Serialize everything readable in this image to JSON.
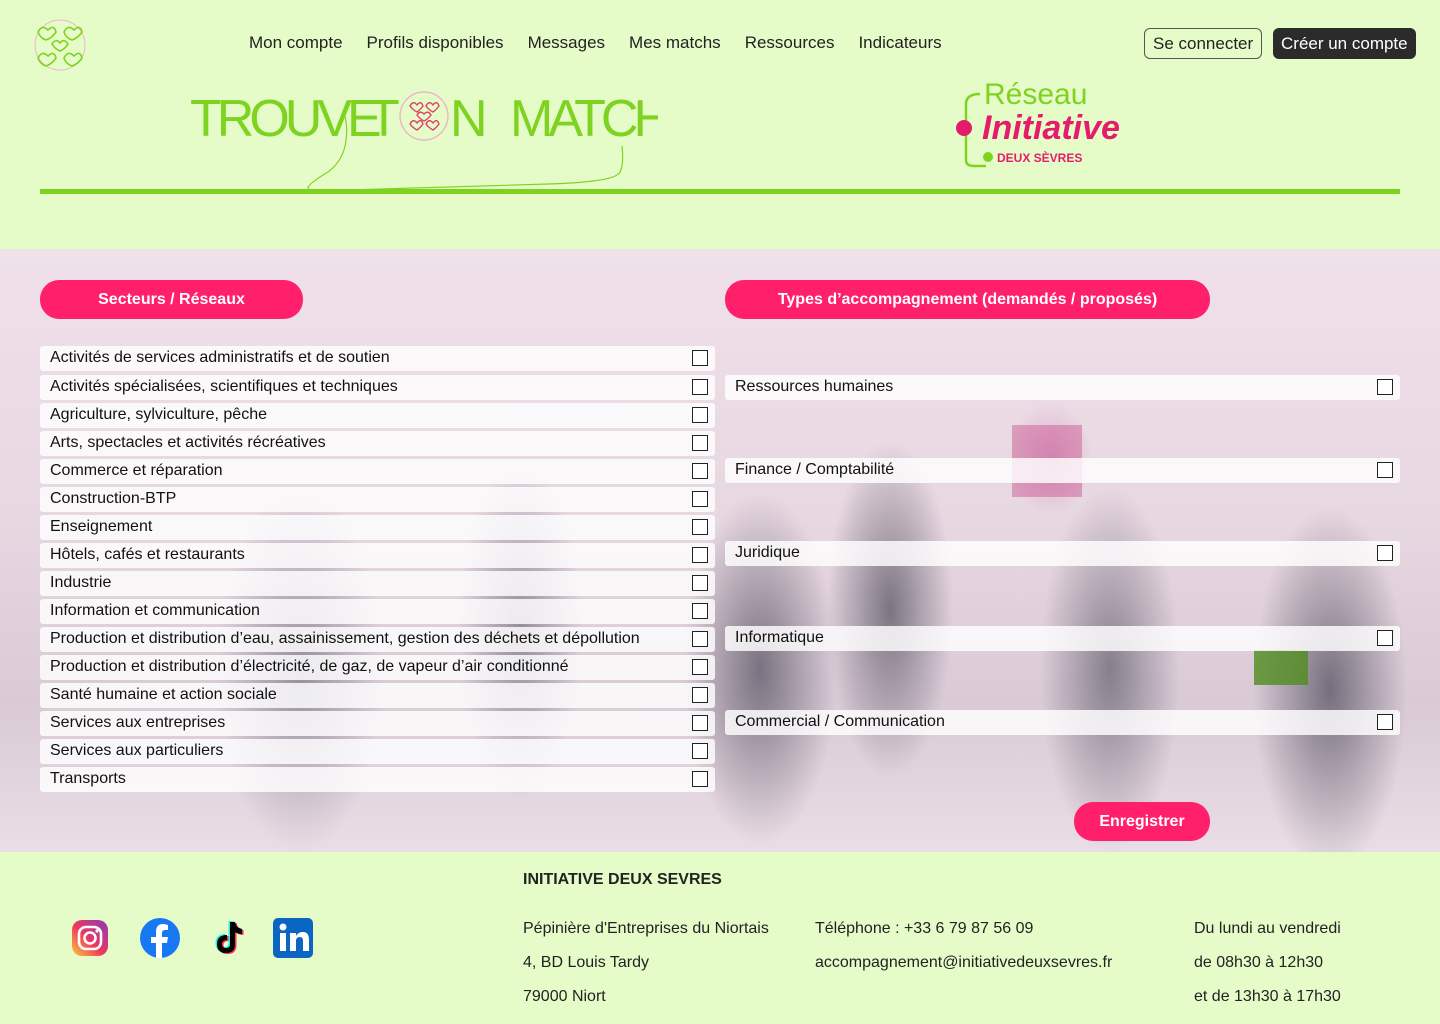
{
  "header": {
    "nav": [
      "Mon compte",
      "Profils disponibles",
      "Messages",
      "Mes matchs",
      "Ressources",
      "Indicateurs"
    ],
    "login_label": "Se connecter",
    "signup_label": "Créer un compte",
    "brand_logo": {
      "part1": "TROUVE",
      "part2": "T",
      "part3": "N",
      "part4": "MATCH"
    },
    "network_logo": {
      "line1": "Réseau",
      "line2": "Initiative",
      "line3": "DEUX SÈVRES"
    }
  },
  "colors": {
    "accent": "#ff1f6b",
    "background": "#e6fcc8",
    "green": "#7ed321",
    "dark": "#2b2b2b"
  },
  "sectors": {
    "title": "Secteurs / Réseaux",
    "items": [
      "Activités de services administratifs et de soutien",
      "Activités spécialisées, scientifiques et techniques",
      "Agriculture, sylviculture, pêche",
      "Arts, spectacles et activités récréatives",
      "Commerce et réparation",
      "Construction-BTP",
      "Enseignement",
      "Hôtels, cafés et restaurants",
      "Industrie",
      "Information et communication",
      "Production et distribution d’eau, assainissement, gestion des déchets et dépollution",
      "Production et distribution d’électricité, de gaz, de vapeur d’air conditionné",
      "Santé humaine et action sociale",
      "Services aux entreprises",
      "Services aux particuliers",
      "Transports"
    ]
  },
  "support": {
    "title": "Types d’accompagnement (demandés / proposés)",
    "items": [
      "Ressources humaines",
      "Finance / Comptabilité",
      "Juridique",
      "Informatique",
      "Commercial / Communication"
    ]
  },
  "save_label": "Enregistrer",
  "footer": {
    "title": "INITIATIVE DEUX SEVRES",
    "address": [
      "Pépinière d'Entreprises du Niortais",
      "4, BD Louis Tardy",
      "79000 Niort"
    ],
    "contact": [
      "Téléphone : +33 6 79 87 56 09",
      "accompagnement@initiativedeuxsevres.fr"
    ],
    "hours": [
      "Du lundi au vendredi",
      "de 08h30 à 12h30",
      "et de 13h30 à 17h30"
    ],
    "social": [
      "instagram-icon",
      "facebook-icon",
      "tiktok-icon",
      "linkedin-icon"
    ]
  }
}
